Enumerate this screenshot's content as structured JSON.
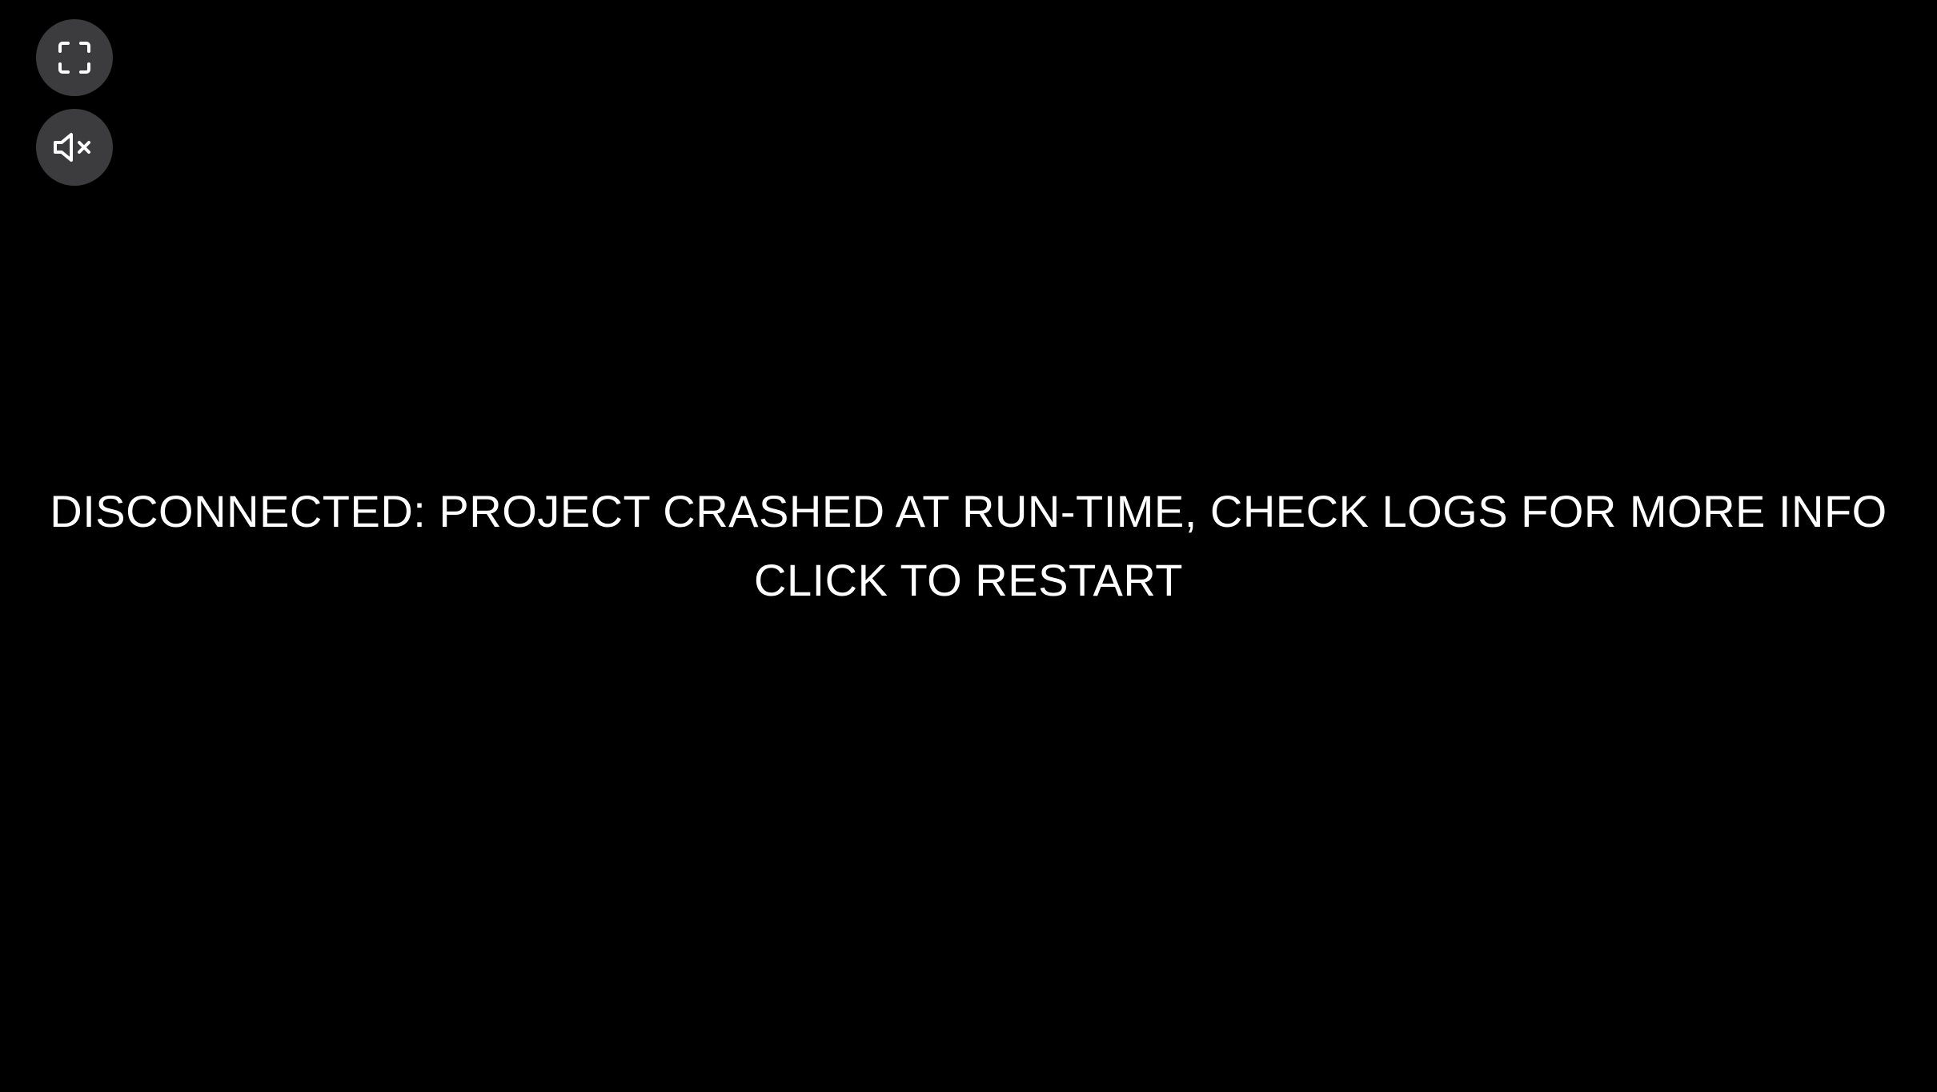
{
  "controls": {
    "fullscreen_icon": "fullscreen-icon",
    "mute_icon": "volume-muted-icon",
    "button_color": "#3c3c3f"
  },
  "status": {
    "line1": "DISCONNECTED: PROJECT CRASHED AT RUN-TIME, CHECK LOGS FOR MORE INFO",
    "line2": "CLICK TO RESTART"
  },
  "colors": {
    "background": "#000000",
    "text": "#ffffff"
  }
}
